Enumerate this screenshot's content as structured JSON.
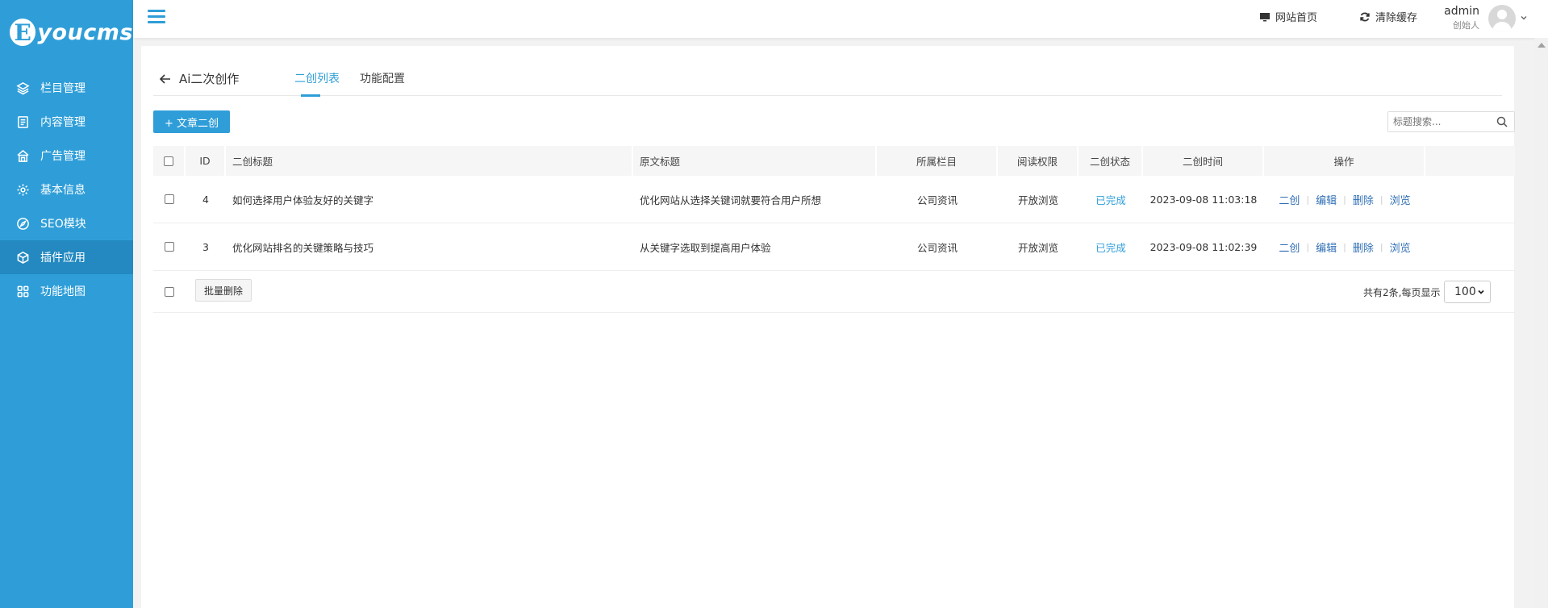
{
  "brand": {
    "logo_letter": "E",
    "logo_text": "youcms"
  },
  "sidebar": {
    "items": [
      {
        "label": "栏目管理",
        "icon": "layers-icon"
      },
      {
        "label": "内容管理",
        "icon": "document-icon"
      },
      {
        "label": "广告管理",
        "icon": "house-icon"
      },
      {
        "label": "基本信息",
        "icon": "gear-icon"
      },
      {
        "label": "SEO模块",
        "icon": "compass-icon"
      },
      {
        "label": "插件应用",
        "icon": "cube-icon",
        "active": true
      },
      {
        "label": "功能地图",
        "icon": "grid-icon"
      }
    ]
  },
  "topbar": {
    "site_home": "网站首页",
    "clear_cache": "清除缓存",
    "user_name": "admin",
    "user_role": "创始人"
  },
  "page": {
    "title": "Ai二次创作",
    "tabs": [
      "二创列表",
      "功能配置"
    ],
    "add_button": "+ 文章二创",
    "search_placeholder": "标题搜索..."
  },
  "table": {
    "headers": {
      "id": "ID",
      "title": "二创标题",
      "orig": "原文标题",
      "column": "所属栏目",
      "perm": "阅读权限",
      "status": "二创状态",
      "time": "二创时间",
      "ops": "操作"
    },
    "rows": [
      {
        "id": "4",
        "title": "如何选择用户体验友好的关键字",
        "orig": "优化网站从选择关键词就要符合用户所想",
        "column": "公司资讯",
        "perm": "开放浏览",
        "status": "已完成",
        "time": "2023-09-08 11:03:18"
      },
      {
        "id": "3",
        "title": "优化网站排名的关键策略与技巧",
        "orig": "从关键字选取到提高用户体验",
        "column": "公司资讯",
        "perm": "开放浏览",
        "status": "已完成",
        "time": "2023-09-08 11:02:39"
      }
    ],
    "ops": [
      "二创",
      "编辑",
      "删除",
      "浏览"
    ]
  },
  "footer": {
    "batch_delete": "批量删除",
    "page_info": "共有2条,每页显示",
    "page_size": "100"
  },
  "colors": {
    "accent": "#2f9ed8",
    "sidebar_active": "#2389c0",
    "link": "#2f6fb5"
  }
}
